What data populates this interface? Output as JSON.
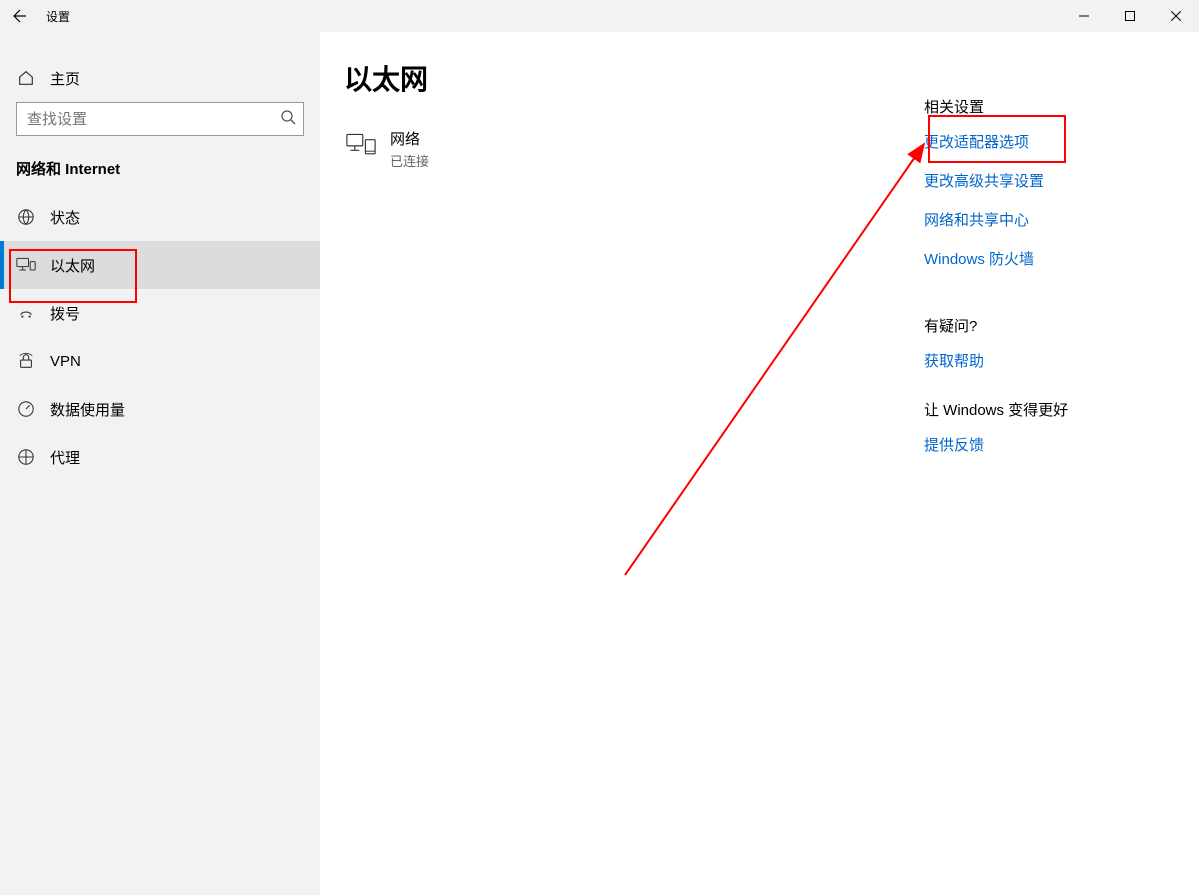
{
  "titlebar": {
    "title": "设置"
  },
  "sidebar": {
    "home": "主页",
    "search_placeholder": "查找设置",
    "heading": "网络和 Internet",
    "items": [
      {
        "label": "状态",
        "icon": "globe",
        "active": false
      },
      {
        "label": "以太网",
        "icon": "ethernet",
        "active": true
      },
      {
        "label": "拨号",
        "icon": "dialup",
        "active": false
      },
      {
        "label": "VPN",
        "icon": "vpn",
        "active": false
      },
      {
        "label": "数据使用量",
        "icon": "meter",
        "active": false
      },
      {
        "label": "代理",
        "icon": "proxy",
        "active": false
      }
    ]
  },
  "main": {
    "title": "以太网",
    "network": {
      "name": "网络",
      "status": "已连接"
    }
  },
  "right": {
    "related_heading": "相关设置",
    "related_links": [
      "更改适配器选项",
      "更改高级共享设置",
      "网络和共享中心",
      "Windows 防火墙"
    ],
    "question_heading": "有疑问?",
    "question_link": "获取帮助",
    "improve_heading": "让 Windows 变得更好",
    "improve_link": "提供反馈"
  },
  "annotations": {
    "box1_target": "以太网 (sidebar item)",
    "box2_target": "更改适配器选项 (link)"
  }
}
